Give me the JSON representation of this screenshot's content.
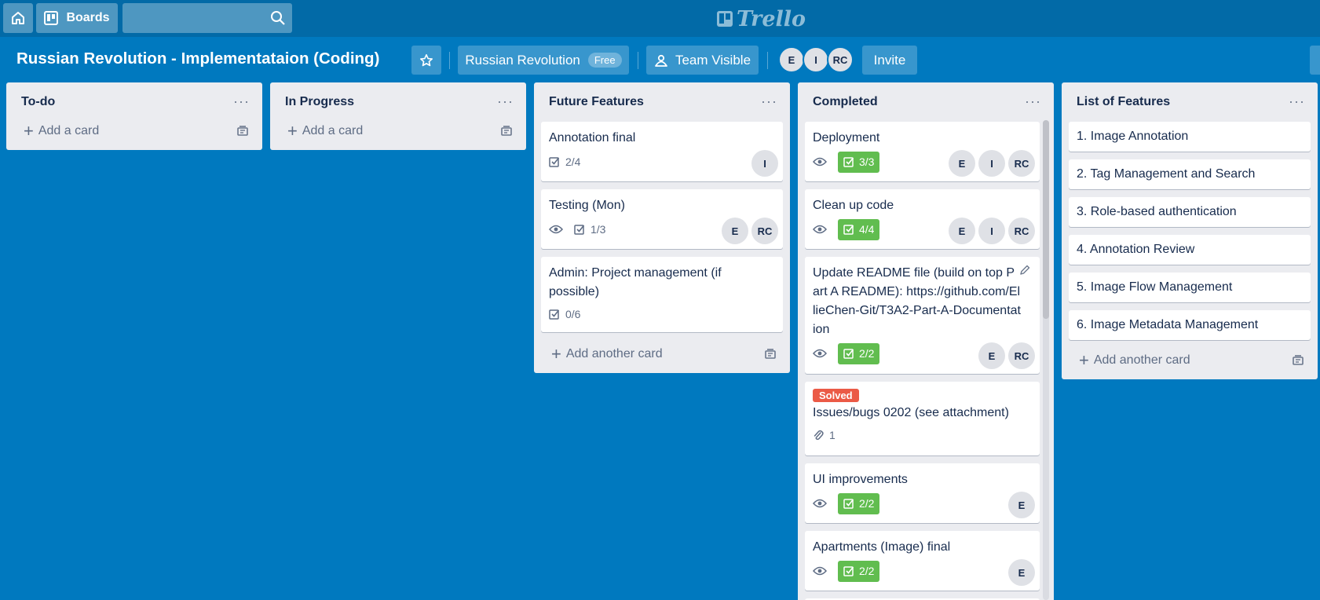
{
  "topbar": {
    "boards_label": "Boards",
    "search": {
      "value": "",
      "placeholder": ""
    },
    "logo_text": "Trello",
    "icons": [
      "home-icon",
      "boards-icon",
      "search-icon",
      "trello-logo-icon"
    ]
  },
  "board": {
    "title": "Russian Revolution - Implementataion (Coding)",
    "team_name": "Russian Revolution",
    "team_plan": "Free",
    "visibility": "Team Visible",
    "members": [
      "E",
      "I",
      "RC"
    ],
    "invite_label": "Invite",
    "background_color": "#0079bf"
  },
  "lists": [
    {
      "title": "To-do",
      "menu": "···",
      "cards": [],
      "add_label": "Add a card"
    },
    {
      "title": "In Progress",
      "menu": "···",
      "cards": [],
      "add_label": "Add a card"
    },
    {
      "title": "Future Features",
      "menu": "···",
      "cards": [
        {
          "title": "Annotation final",
          "checklist": "2/4",
          "members": [
            "I"
          ]
        },
        {
          "title": "Testing (Mon)",
          "watching": true,
          "checklist": "1/3",
          "members": [
            "E",
            "RC"
          ]
        },
        {
          "title": "Admin: Project management (if possible)",
          "checklist": "0/6",
          "members": []
        }
      ],
      "add_label": "Add another card"
    },
    {
      "title": "Completed",
      "menu": "···",
      "cards": [
        {
          "title": "Deployment",
          "watching": true,
          "checklist": "3/3",
          "checklist_complete": true,
          "members": [
            "E",
            "I",
            "RC"
          ]
        },
        {
          "title": "Clean up code",
          "watching": true,
          "checklist": "4/4",
          "checklist_complete": true,
          "members": [
            "E",
            "I",
            "RC"
          ]
        },
        {
          "title": "Update README file (build on top Part A README): https://github.com/EllieChen-Git/T3A2-Part-A-Documentation",
          "watching": true,
          "checklist": "2/2",
          "checklist_complete": true,
          "members": [
            "E",
            "RC"
          ]
        },
        {
          "label": "Solved",
          "label_color": "#eb5a46",
          "title": "Issues/bugs 0202 (see attachment)",
          "attachments": "1",
          "members": []
        },
        {
          "title": "UI improvements",
          "watching": true,
          "checklist": "2/2",
          "checklist_complete": true,
          "members": [
            "E"
          ]
        },
        {
          "title": "Apartments (Image) final",
          "watching": true,
          "checklist": "2/2",
          "checklist_complete": true,
          "members": [
            "E"
          ]
        }
      ]
    },
    {
      "title": "List of Features",
      "menu": "···",
      "cards": [
        {
          "title": "1. Image Annotation"
        },
        {
          "title": "2. Tag Management and Search"
        },
        {
          "title": "3. Role-based authentication"
        },
        {
          "title": "4. Annotation Review"
        },
        {
          "title": "5. Image Flow Management"
        },
        {
          "title": "6. Image Metadata Management"
        }
      ],
      "add_label": "Add another card"
    }
  ],
  "colors": {
    "topbar": "#026aa7",
    "list_bg": "#ebecf0",
    "checklist_complete": "#61bd4f",
    "label_red": "#eb5a46"
  }
}
